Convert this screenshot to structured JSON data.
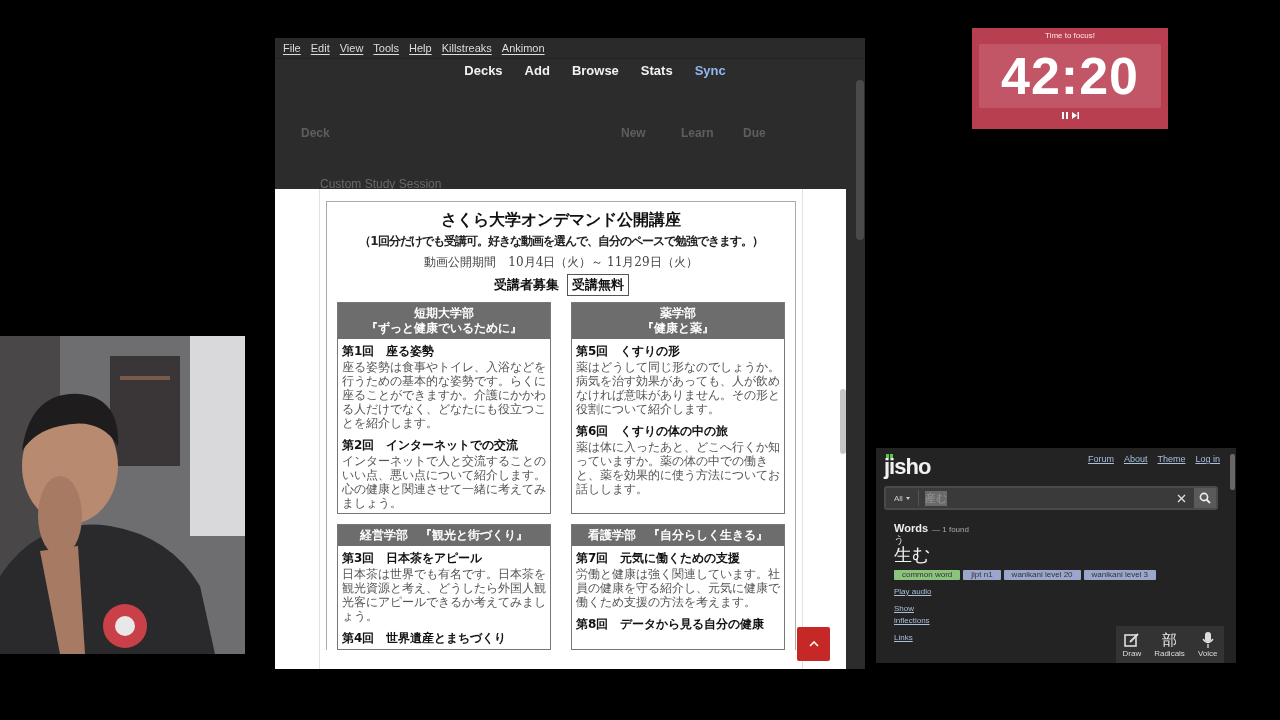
{
  "anki": {
    "menu": [
      "File",
      "Edit",
      "View",
      "Tools",
      "Help",
      "Killstreaks",
      "Ankimon"
    ],
    "toolbar": [
      {
        "label": "Decks",
        "highlighted": false
      },
      {
        "label": "Add",
        "highlighted": false
      },
      {
        "label": "Browse",
        "highlighted": false
      },
      {
        "label": "Stats",
        "highlighted": false
      },
      {
        "label": "Sync",
        "highlighted": true
      }
    ],
    "deck_table": {
      "columns": [
        "Deck",
        "New",
        "Learn",
        "Due"
      ],
      "rows": [
        {
          "name": "Custom Study Session"
        }
      ]
    }
  },
  "document": {
    "title": "さくら大学オンデマンド公開講座",
    "subtitle": "（1回分だけでも受講可。好きな動画を選んで、自分のペースで勉強できます。）",
    "period": "動画公開期間　10月4日（火）～ 11月29日（火）",
    "recruit": "受講者募集",
    "free_badge": "受講無料",
    "courses": [
      {
        "header": [
          "短期大学部",
          "『ずっと健康でいるために』"
        ],
        "lessons": [
          {
            "title": "第1回　座る姿勢",
            "body": "座る姿勢は食事やトイレ、入浴などを行うための基本的な姿勢です。らくに座ることができますか。介護にかかわる人だけでなく、どなたにも役立つことを紹介します。"
          },
          {
            "title": "第2回　インターネットでの交流",
            "body": "インターネットで人と交流することのいい点、悪い点について紹介します。心の健康と関連させて一緒に考えてみましょう。"
          }
        ]
      },
      {
        "header": [
          "薬学部",
          "『健康と薬』"
        ],
        "lessons": [
          {
            "title": "第5回　くすりの形",
            "body": "薬はどうして同じ形なのでしょうか。病気を治す効果があっても、人が飲めなければ意味がありません。その形と役割について紹介します。"
          },
          {
            "title": "第6回　くすりの体の中の旅",
            "body": "薬は体に入ったあと、どこへ行くか知っていますか。薬の体の中での働きと、薬を効果的に使う方法についてお話しします。"
          }
        ]
      },
      {
        "header": [
          "経営学部　『観光と街づくり』"
        ],
        "lessons": [
          {
            "title": "第3回　日本茶をアピール",
            "body": "日本茶は世界でも有名です。日本茶を観光資源と考え、どうしたら外国人観光客にアピールできるか考えてみましょう。"
          },
          {
            "title": "第4回　世界遺産とまちづくり"
          }
        ]
      },
      {
        "header": [
          "看護学部　『自分らしく生きる』"
        ],
        "lessons": [
          {
            "title": "第7回　元気に働くための支援",
            "body": "労働と健康は強く関連しています。社員の健康を守る紹介し、元気に健康で働くため支援の方法を考えます。"
          },
          {
            "title": "第8回　データから見る自分の健康"
          }
        ]
      }
    ]
  },
  "timer": {
    "label": "Time to focus!",
    "time": "42:20"
  },
  "jisho": {
    "logo": "jisho",
    "nav": [
      "Forum",
      "About",
      "Theme",
      "Log in"
    ],
    "search": {
      "filter": "All",
      "value": "産む"
    },
    "words": {
      "heading": "Words",
      "count": "— 1 found",
      "reading": "う",
      "word": "生む",
      "tags": [
        {
          "label": "common word",
          "color": "#8cc47e"
        },
        {
          "label": "jlpt n1",
          "color": "#9aa6cc"
        },
        {
          "label": "wanikani level 20",
          "color": "#9aa6cc"
        },
        {
          "label": "wanikani level 3",
          "color": "#9aa6cc"
        }
      ],
      "links": [
        "Play audio",
        "Show inflections",
        "Links"
      ]
    },
    "tools": [
      {
        "kind": "draw",
        "label": "Draw"
      },
      {
        "kind": "radicals",
        "glyph": "部",
        "label": "Radicals"
      },
      {
        "kind": "voice",
        "label": "Voice"
      }
    ]
  }
}
